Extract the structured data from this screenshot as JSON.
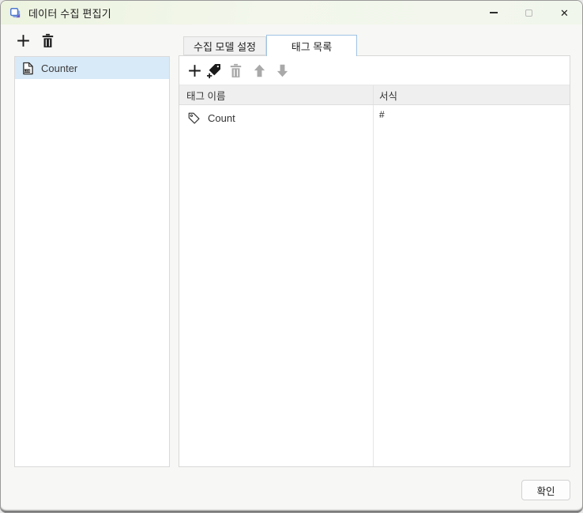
{
  "titlebar": {
    "title": "데이터 수집 편집기",
    "icons": {
      "app": "app-logo",
      "minimize": "minimize",
      "maximize": "maximize",
      "close_glyph": "✕"
    }
  },
  "model_list": {
    "toolbar": [
      {
        "name": "add-model",
        "icon": "plus-icon",
        "enabled": true
      },
      {
        "name": "delete-model",
        "icon": "trash-icon",
        "enabled": true
      }
    ],
    "items": [
      {
        "label": "Counter",
        "icon": "log-file-icon",
        "selected": true
      }
    ]
  },
  "tabs": [
    {
      "label": "수집 모델 설정",
      "active": false
    },
    {
      "label": "태그 목록",
      "active": true
    }
  ],
  "tag_list": {
    "toolbar": [
      {
        "name": "add-tag",
        "icon": "plus-icon",
        "enabled": true
      },
      {
        "name": "new-tag",
        "icon": "tag-plus-icon",
        "enabled": true
      },
      {
        "name": "delete-tag",
        "icon": "trash-icon",
        "enabled": false
      },
      {
        "name": "move-up",
        "icon": "arrow-up-icon",
        "enabled": false
      },
      {
        "name": "move-down",
        "icon": "arrow-down-icon",
        "enabled": false
      }
    ],
    "columns": [
      "태그 이름",
      "서식"
    ],
    "rows": [
      {
        "name": "Count",
        "icon": "tag-icon",
        "format": "#"
      }
    ]
  },
  "footer": {
    "ok": "확인"
  },
  "colors": {
    "selection_bg": "#d8eaf8",
    "active_tab_border": "#9fc3e4",
    "titlebar_tint": "#ecf3df",
    "header_bg": "#efefef",
    "disabled_icon": "#a9a9a9",
    "enabled_icon": "#1a1a1a"
  }
}
